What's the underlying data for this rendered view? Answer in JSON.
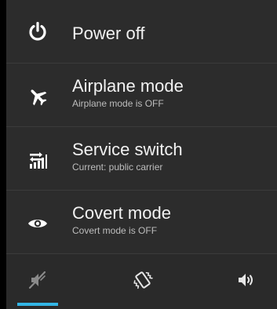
{
  "menu": {
    "items": [
      {
        "title": "Power off",
        "subtitle": null,
        "icon": "power-icon"
      },
      {
        "title": "Airplane mode",
        "subtitle": "Airplane mode is OFF",
        "icon": "airplane-icon"
      },
      {
        "title": "Service switch",
        "subtitle": "Current: public carrier",
        "icon": "service-switch-icon"
      },
      {
        "title": "Covert mode",
        "subtitle": "Covert mode is OFF",
        "icon": "eye-icon"
      }
    ]
  },
  "sound_modes": {
    "options": [
      {
        "name": "silent",
        "icon": "silent-icon",
        "selected": true
      },
      {
        "name": "vibrate",
        "icon": "vibrate-icon",
        "selected": false
      },
      {
        "name": "sound on",
        "icon": "sound-on-icon",
        "selected": false
      }
    ],
    "accent_color": "#33b5e5"
  },
  "colors": {
    "background": "#2c2c2c",
    "text": "#f2f2f2",
    "subtext": "#bdbdbd"
  }
}
